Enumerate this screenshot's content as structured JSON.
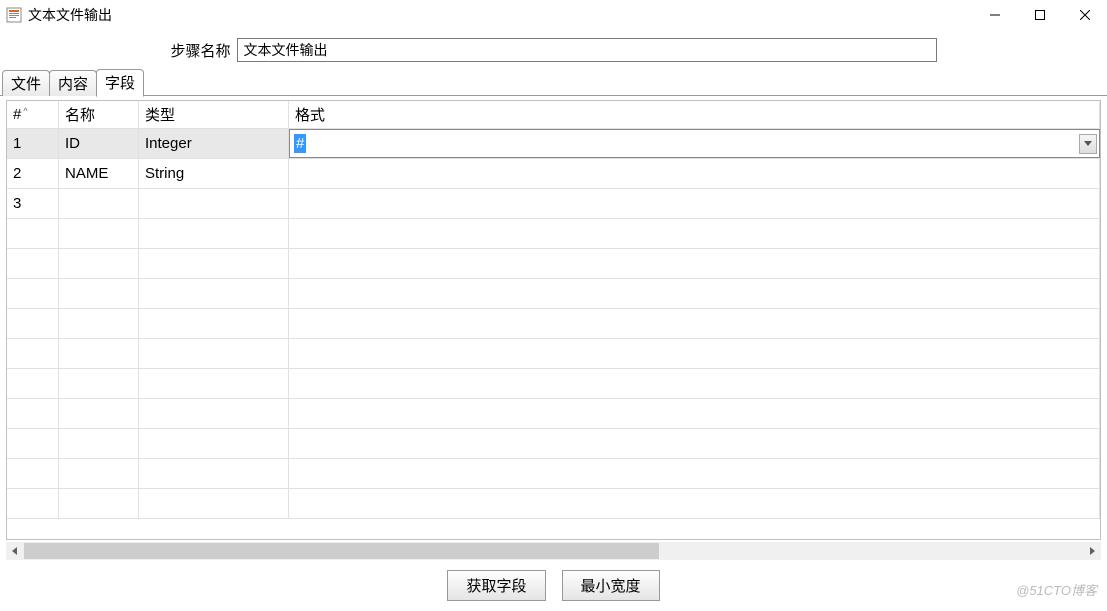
{
  "window": {
    "title": "文本文件输出"
  },
  "step": {
    "label": "步骤名称",
    "value": "文本文件输出"
  },
  "tabs": [
    {
      "label": "文件"
    },
    {
      "label": "内容"
    },
    {
      "label": "字段"
    }
  ],
  "active_tab_index": 2,
  "columns": {
    "num": "#",
    "name": "名称",
    "type": "类型",
    "format": "格式"
  },
  "rows": [
    {
      "num": "1",
      "name": "ID",
      "type": "Integer",
      "format": "#",
      "selected": true,
      "editing_format": true
    },
    {
      "num": "2",
      "name": "NAME",
      "type": "String",
      "format": ""
    },
    {
      "num": "3",
      "name": "",
      "type": "",
      "format": ""
    },
    {
      "num": "",
      "name": "",
      "type": "",
      "format": ""
    },
    {
      "num": "",
      "name": "",
      "type": "",
      "format": ""
    },
    {
      "num": "",
      "name": "",
      "type": "",
      "format": ""
    },
    {
      "num": "",
      "name": "",
      "type": "",
      "format": ""
    },
    {
      "num": "",
      "name": "",
      "type": "",
      "format": ""
    },
    {
      "num": "",
      "name": "",
      "type": "",
      "format": ""
    },
    {
      "num": "",
      "name": "",
      "type": "",
      "format": ""
    },
    {
      "num": "",
      "name": "",
      "type": "",
      "format": ""
    },
    {
      "num": "",
      "name": "",
      "type": "",
      "format": ""
    },
    {
      "num": "",
      "name": "",
      "type": "",
      "format": ""
    }
  ],
  "buttons": {
    "get_fields": "获取字段",
    "min_width": "最小宽度"
  },
  "watermark": "@51CTO博客"
}
